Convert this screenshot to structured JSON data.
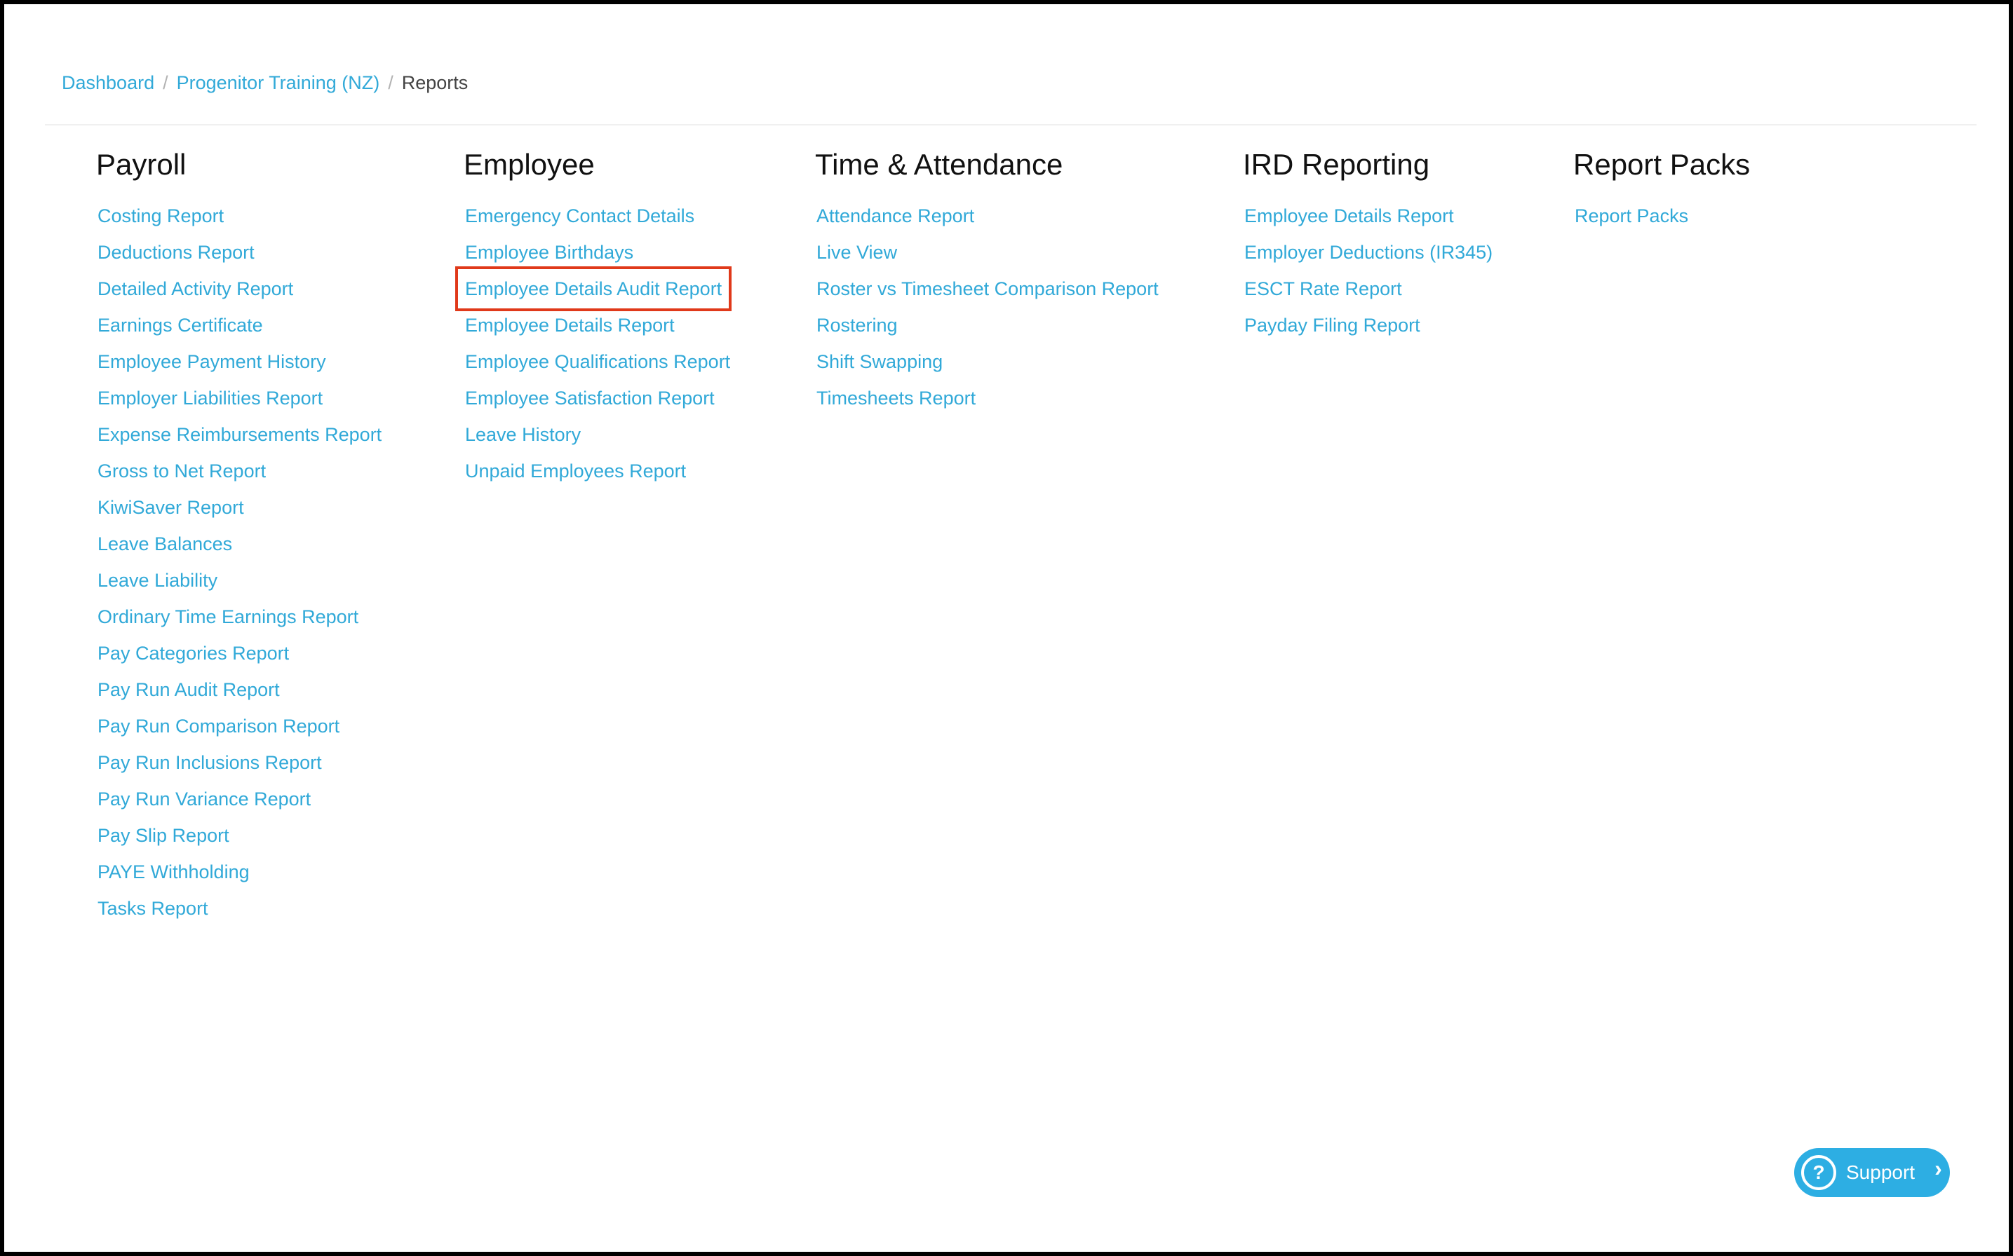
{
  "breadcrumb": {
    "items": [
      "Dashboard",
      "Progenitor Training (NZ)"
    ],
    "separator": "/",
    "current": "Reports"
  },
  "columns": [
    {
      "title": "Payroll",
      "links": [
        "Costing Report",
        "Deductions Report",
        "Detailed Activity Report",
        "Earnings Certificate",
        "Employee Payment History",
        "Employer Liabilities Report",
        "Expense Reimbursements Report",
        "Gross to Net Report",
        "KiwiSaver Report",
        "Leave Balances",
        "Leave Liability",
        "Ordinary Time Earnings Report",
        "Pay Categories Report",
        "Pay Run Audit Report",
        "Pay Run Comparison Report",
        "Pay Run Inclusions Report",
        "Pay Run Variance Report",
        "Pay Slip Report",
        "PAYE Withholding",
        "Tasks Report"
      ]
    },
    {
      "title": "Employee",
      "links": [
        "Emergency Contact Details",
        "Employee Birthdays",
        "Employee Details Audit Report",
        "Employee Details Report",
        "Employee Qualifications Report",
        "Employee Satisfaction Report",
        "Leave History",
        "Unpaid Employees Report"
      ]
    },
    {
      "title": "Time & Attendance",
      "links": [
        "Attendance Report",
        "Live View",
        "Roster vs Timesheet Comparison Report",
        "Rostering",
        "Shift Swapping",
        "Timesheets Report"
      ]
    },
    {
      "title": "IRD Reporting",
      "links": [
        "Employee Details Report",
        "Employer Deductions (IR345)",
        "ESCT Rate Report",
        "Payday Filing Report"
      ]
    },
    {
      "title": "Report Packs",
      "links": [
        "Report Packs"
      ]
    }
  ],
  "highlight": {
    "column": 1,
    "link": 2,
    "color": "#e0391a"
  },
  "support": {
    "label": "Support",
    "help_icon": "?",
    "chevron_icon": "›"
  },
  "colors": {
    "link": "#31a9d8",
    "heading": "#111111",
    "support_bg": "#2daee3"
  }
}
